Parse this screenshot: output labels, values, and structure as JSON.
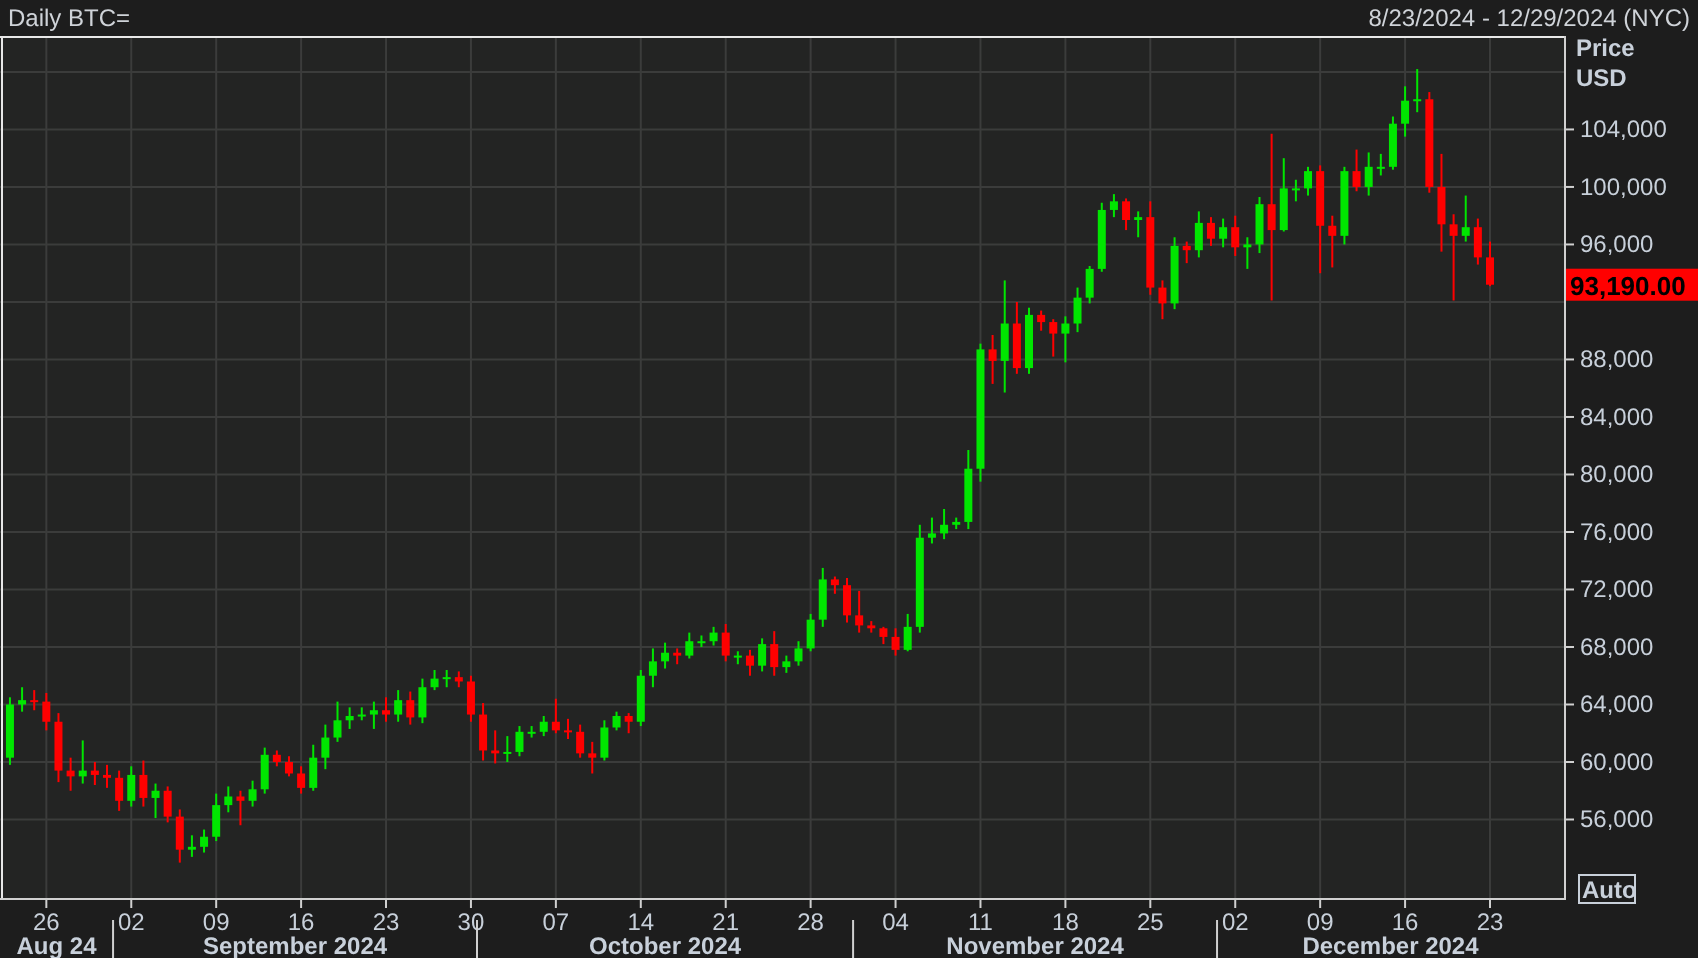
{
  "header": {
    "title": "Daily BTC=",
    "date_range": "8/23/2024 - 12/29/2024 (NYC)"
  },
  "chart": {
    "last_price_label": "93,190.00",
    "scale_button": "Auto",
    "chart_data": {
      "type": "candlestick",
      "ylabel": "Price USD",
      "grid": true,
      "ylim": [
        50400,
        110500
      ],
      "categories": [
        null,
        null,
        null,
        "26",
        null,
        null,
        null,
        null,
        null,
        null,
        "02",
        null,
        null,
        null,
        null,
        null,
        null,
        "09",
        null,
        null,
        null,
        null,
        null,
        null,
        "16",
        null,
        null,
        null,
        null,
        null,
        null,
        "23",
        null,
        null,
        null,
        null,
        null,
        null,
        "30",
        null,
        null,
        null,
        null,
        null,
        null,
        "07",
        null,
        null,
        null,
        null,
        null,
        null,
        "14",
        null,
        null,
        null,
        null,
        null,
        null,
        "21",
        null,
        null,
        null,
        null,
        null,
        null,
        "28",
        null,
        null,
        null,
        null,
        null,
        null,
        "04",
        null,
        null,
        null,
        null,
        null,
        null,
        "11",
        null,
        null,
        null,
        null,
        null,
        null,
        "18",
        null,
        null,
        null,
        null,
        null,
        null,
        "25",
        null,
        null,
        null,
        null,
        null,
        null,
        "02",
        null,
        null,
        null,
        null,
        null,
        null,
        "09",
        null,
        null,
        null,
        null,
        null,
        null,
        "16",
        null,
        null,
        null,
        null,
        null,
        null,
        "23"
      ],
      "ohlc": [
        [
          60300,
          64500,
          59800,
          64000
        ],
        [
          64000,
          65200,
          63500,
          64300
        ],
        [
          64300,
          65000,
          63600,
          64200
        ],
        [
          64200,
          64800,
          62200,
          62800
        ],
        [
          62800,
          63400,
          58600,
          59400
        ],
        [
          59400,
          60300,
          58000,
          59000
        ],
        [
          59000,
          61500,
          58500,
          59400
        ],
        [
          59400,
          60000,
          58400,
          59100
        ],
        [
          59100,
          59800,
          58200,
          58900
        ],
        [
          58900,
          59400,
          56600,
          57300
        ],
        [
          57300,
          59700,
          56900,
          59100
        ],
        [
          59100,
          60100,
          56900,
          57500
        ],
        [
          57500,
          58500,
          56100,
          58000
        ],
        [
          58000,
          58300,
          55800,
          56200
        ],
        [
          56200,
          56700,
          53000,
          53900
        ],
        [
          53900,
          54900,
          53400,
          54100
        ],
        [
          54100,
          55300,
          53700,
          54800
        ],
        [
          54800,
          57800,
          54500,
          57000
        ],
        [
          57000,
          58300,
          56500,
          57600
        ],
        [
          57600,
          58000,
          55600,
          57300
        ],
        [
          57300,
          58700,
          56900,
          58100
        ],
        [
          58100,
          61000,
          57800,
          60500
        ],
        [
          60500,
          60800,
          59700,
          60000
        ],
        [
          60000,
          60400,
          59000,
          59200
        ],
        [
          59200,
          59700,
          57800,
          58200
        ],
        [
          58200,
          61200,
          58000,
          60300
        ],
        [
          60300,
          62600,
          59500,
          61700
        ],
        [
          61700,
          64200,
          61400,
          62900
        ],
        [
          62900,
          63800,
          62300,
          63200
        ],
        [
          63200,
          63800,
          62900,
          63300
        ],
        [
          63300,
          64200,
          62300,
          63600
        ],
        [
          63600,
          64500,
          62800,
          63300
        ],
        [
          63300,
          65000,
          62800,
          64300
        ],
        [
          64300,
          64900,
          62600,
          63100
        ],
        [
          63100,
          65800,
          62700,
          65200
        ],
        [
          65200,
          66400,
          65000,
          65800
        ],
        [
          65800,
          66400,
          65200,
          65900
        ],
        [
          65900,
          66300,
          65200,
          65600
        ],
        [
          65600,
          66000,
          62800,
          63300
        ],
        [
          63300,
          64100,
          60100,
          60800
        ],
        [
          60800,
          62200,
          59900,
          60600
        ],
        [
          60600,
          61800,
          60000,
          60700
        ],
        [
          60700,
          62500,
          60400,
          62100
        ],
        [
          62100,
          62500,
          61700,
          62100
        ],
        [
          62100,
          63200,
          61800,
          62800
        ],
        [
          62800,
          64400,
          62000,
          62200
        ],
        [
          62200,
          63000,
          61600,
          62100
        ],
        [
          62100,
          62600,
          60300,
          60600
        ],
        [
          60600,
          61400,
          59200,
          60300
        ],
        [
          60300,
          62900,
          60100,
          62400
        ],
        [
          62400,
          63500,
          62200,
          63200
        ],
        [
          63200,
          63400,
          62000,
          62800
        ],
        [
          62800,
          66400,
          62500,
          66000
        ],
        [
          66000,
          67900,
          65200,
          67000
        ],
        [
          67000,
          68300,
          66500,
          67600
        ],
        [
          67600,
          67900,
          66800,
          67400
        ],
        [
          67400,
          69000,
          67200,
          68400
        ],
        [
          68400,
          68800,
          68000,
          68400
        ],
        [
          68400,
          69400,
          68100,
          69000
        ],
        [
          69000,
          69600,
          67000,
          67400
        ],
        [
          67400,
          67700,
          66800,
          67400
        ],
        [
          67400,
          67800,
          66000,
          66700
        ],
        [
          66700,
          68600,
          66300,
          68200
        ],
        [
          68200,
          69100,
          66000,
          66600
        ],
        [
          66600,
          67400,
          66200,
          67000
        ],
        [
          67000,
          68400,
          66700,
          67900
        ],
        [
          67900,
          70300,
          67700,
          69900
        ],
        [
          69900,
          73500,
          69400,
          72700
        ],
        [
          72700,
          72900,
          71700,
          72300
        ],
        [
          72300,
          72800,
          69700,
          70200
        ],
        [
          70200,
          71900,
          69000,
          69500
        ],
        [
          69500,
          69800,
          69000,
          69300
        ],
        [
          69300,
          69400,
          68200,
          68700
        ],
        [
          68700,
          69300,
          67400,
          67800
        ],
        [
          67800,
          70300,
          67700,
          69400
        ],
        [
          69400,
          76500,
          69000,
          75600
        ],
        [
          75600,
          77000,
          75200,
          75900
        ],
        [
          75900,
          77600,
          75500,
          76500
        ],
        [
          76500,
          77000,
          76200,
          76700
        ],
        [
          76700,
          81700,
          76200,
          80400
        ],
        [
          80400,
          89100,
          79500,
          88700
        ],
        [
          88700,
          89700,
          86300,
          87900
        ],
        [
          87900,
          93500,
          85700,
          90500
        ],
        [
          90500,
          92000,
          87000,
          87400
        ],
        [
          87400,
          91600,
          87000,
          91100
        ],
        [
          91100,
          91400,
          90000,
          90600
        ],
        [
          90600,
          90800,
          88200,
          89800
        ],
        [
          89800,
          91000,
          87800,
          90500
        ],
        [
          90500,
          93000,
          89900,
          92300
        ],
        [
          92300,
          94500,
          91900,
          94300
        ],
        [
          94300,
          98900,
          94100,
          98400
        ],
        [
          98400,
          99500,
          97900,
          99000
        ],
        [
          99000,
          99200,
          97000,
          97700
        ],
        [
          97700,
          98300,
          96500,
          97900
        ],
        [
          97900,
          99000,
          92500,
          93000
        ],
        [
          93000,
          93500,
          90800,
          91900
        ],
        [
          91900,
          96500,
          91500,
          95900
        ],
        [
          95900,
          96200,
          94700,
          95600
        ],
        [
          95600,
          98300,
          95100,
          97500
        ],
        [
          97500,
          97900,
          95900,
          96400
        ],
        [
          96400,
          97800,
          95800,
          97200
        ],
        [
          97200,
          98000,
          95200,
          95800
        ],
        [
          95800,
          96500,
          94300,
          96000
        ],
        [
          96000,
          99300,
          95400,
          98800
        ],
        [
          98800,
          103700,
          92100,
          97000
        ],
        [
          97000,
          102000,
          96900,
          99900
        ],
        [
          99900,
          100500,
          99000,
          99900
        ],
        [
          99900,
          101400,
          99400,
          101100
        ],
        [
          101100,
          101500,
          94000,
          97300
        ],
        [
          97300,
          98000,
          94400,
          96600
        ],
        [
          96600,
          101400,
          96000,
          101100
        ],
        [
          101100,
          102600,
          99700,
          100000
        ],
        [
          100000,
          102400,
          99400,
          101400
        ],
        [
          101400,
          102300,
          100800,
          101400
        ],
        [
          101400,
          104900,
          101200,
          104400
        ],
        [
          104400,
          107000,
          103500,
          106000
        ],
        [
          106000,
          108200,
          105200,
          106100
        ],
        [
          106100,
          106600,
          99600,
          100000
        ],
        [
          100000,
          102300,
          95500,
          97400
        ],
        [
          97400,
          98100,
          92100,
          96600
        ],
        [
          96600,
          99400,
          96200,
          97200
        ],
        [
          97200,
          97800,
          94600,
          95100
        ],
        [
          95100,
          96200,
          93100,
          93200
        ]
      ],
      "yticks": [
        {
          "value": 56000,
          "label": "56,000"
        },
        {
          "value": 60000,
          "label": "60,000"
        },
        {
          "value": 64000,
          "label": "64,000"
        },
        {
          "value": 68000,
          "label": "68,000"
        },
        {
          "value": 72000,
          "label": "72,000"
        },
        {
          "value": 76000,
          "label": "76,000"
        },
        {
          "value": 80000,
          "label": "80,000"
        },
        {
          "value": 84000,
          "label": "84,000"
        },
        {
          "value": 88000,
          "label": "88,000"
        },
        {
          "value": 96000,
          "label": "96,000"
        },
        {
          "value": 100000,
          "label": "100,000"
        },
        {
          "value": 104000,
          "label": "104,000"
        }
      ],
      "annotations": [
        "Aug 24",
        "September 2024",
        "October 2024",
        "November 2024",
        "December 2024"
      ]
    }
  }
}
